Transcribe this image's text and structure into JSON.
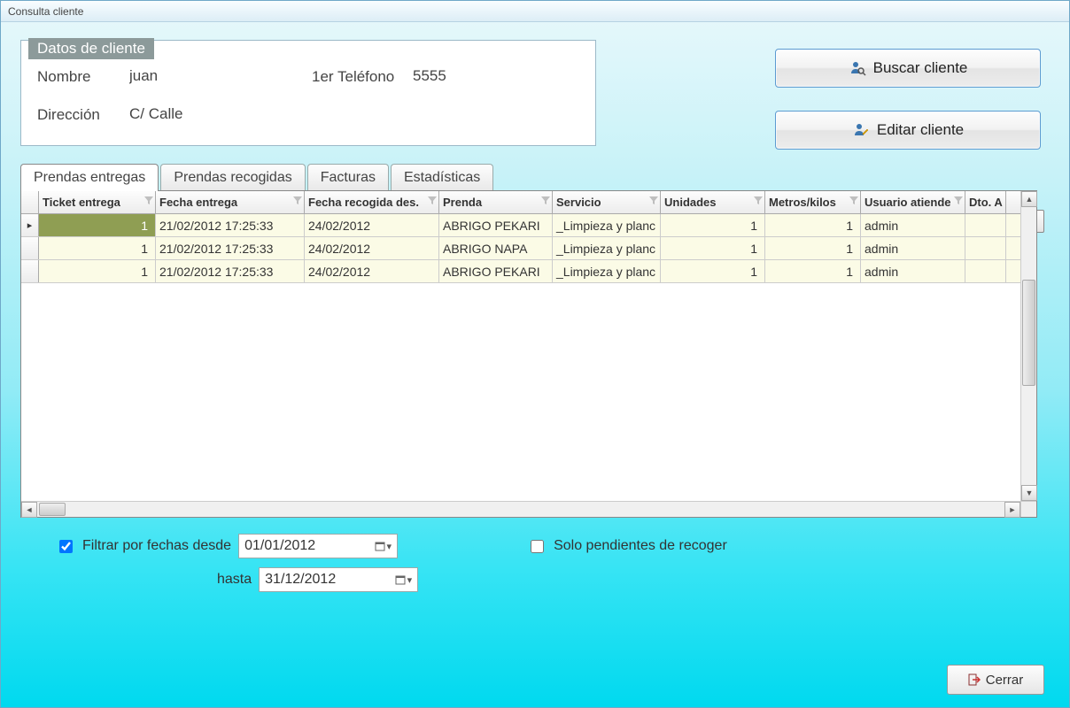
{
  "window": {
    "title": "Consulta cliente"
  },
  "fieldset": {
    "legend": "Datos de cliente",
    "nombre_label": "Nombre",
    "nombre_value": "juan",
    "tel_label": "1er Teléfono",
    "tel_value": "5555",
    "dir_label": "Dirección",
    "dir_value": "C/ Calle"
  },
  "buttons": {
    "buscar": "Buscar cliente",
    "editar": "Editar cliente",
    "cerrar": "Cerrar"
  },
  "tabs": {
    "entregas": "Prendas entregas",
    "recogidas": "Prendas recogidas",
    "facturas": "Facturas",
    "stats": "Estadísticas"
  },
  "grid": {
    "headers": {
      "ticket": "Ticket entrega",
      "fecha_entrega": "Fecha entrega",
      "fecha_recogida": "Fecha recogida des.",
      "prenda": "Prenda",
      "servicio": "Servicio",
      "unidades": "Unidades",
      "metros": "Metros/kilos",
      "usuario": "Usuario atiende",
      "dto": "Dto. A"
    },
    "rows": [
      {
        "ticket": "1",
        "fe": "21/02/2012 17:25:33",
        "fr": "24/02/2012",
        "prenda": "ABRIGO PEKARI",
        "servicio": "_Limpieza y planc",
        "un": "1",
        "mk": "1",
        "user": "admin"
      },
      {
        "ticket": "1",
        "fe": "21/02/2012 17:25:33",
        "fr": "24/02/2012",
        "prenda": "ABRIGO NAPA",
        "servicio": "_Limpieza y planc",
        "un": "1",
        "mk": "1",
        "user": "admin"
      },
      {
        "ticket": "1",
        "fe": "21/02/2012 17:25:33",
        "fr": "24/02/2012",
        "prenda": "ABRIGO PEKARI",
        "servicio": "_Limpieza y planc",
        "un": "1",
        "mk": "1",
        "user": "admin"
      }
    ]
  },
  "filters": {
    "filtrar_fechas": "Filtrar por fechas desde",
    "hasta": "hasta",
    "desde_value": "01/01/2012",
    "hasta_value": "31/12/2012",
    "solo_pendientes": "Solo pendientes de recoger",
    "filtrar_checked": true,
    "pendientes_checked": false
  }
}
